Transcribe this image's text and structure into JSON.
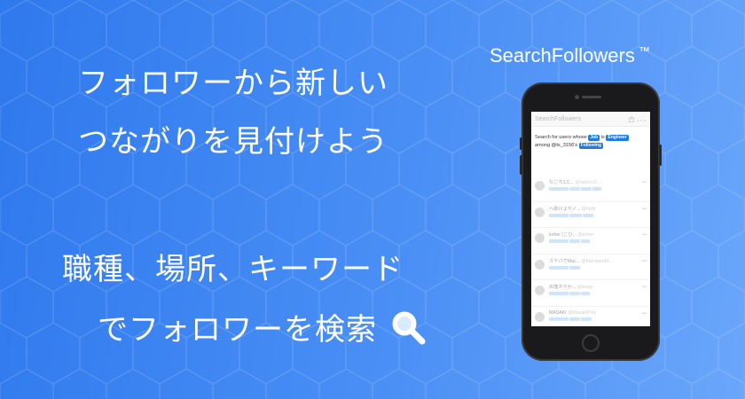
{
  "headline": {
    "line1": "フォロワーから新しい",
    "line2": "つながりを見付けよう",
    "line3": "職種、場所、キーワード",
    "line4": "でフォロワーを検索"
  },
  "brand": {
    "name": "SearchFollowers",
    "mark": "™"
  },
  "app": {
    "title": "SearchFollowers",
    "query": {
      "prefix": "Search for users whose",
      "field_tag": "Job",
      "is_text": "is",
      "value_tag": "Engineer",
      "among_text": "among @ts_3156's",
      "scope_tag": "Following"
    },
    "results": [
      {
        "name": "なごろ1エ...",
        "handle": "@nadoro3..."
      },
      {
        "name": "へ助けよやノ...",
        "handle": "@hpfd"
      },
      {
        "name": "koher (こひ...",
        "handle": "@koher"
      },
      {
        "name": "ステパでMac...",
        "handle": "@Macopentif..."
      },
      {
        "name": "出落ネやか...",
        "handle": "@ieaqy"
      },
      {
        "name": "MASAKI",
        "handle": "@MasakiPrini"
      }
    ]
  },
  "colors": {
    "accent": "#1e7be0",
    "background_start": "#2f79ee",
    "background_end": "#6aa6fb"
  },
  "icons": {
    "headline": "magnifier-icon",
    "appbar": "share-icon"
  }
}
